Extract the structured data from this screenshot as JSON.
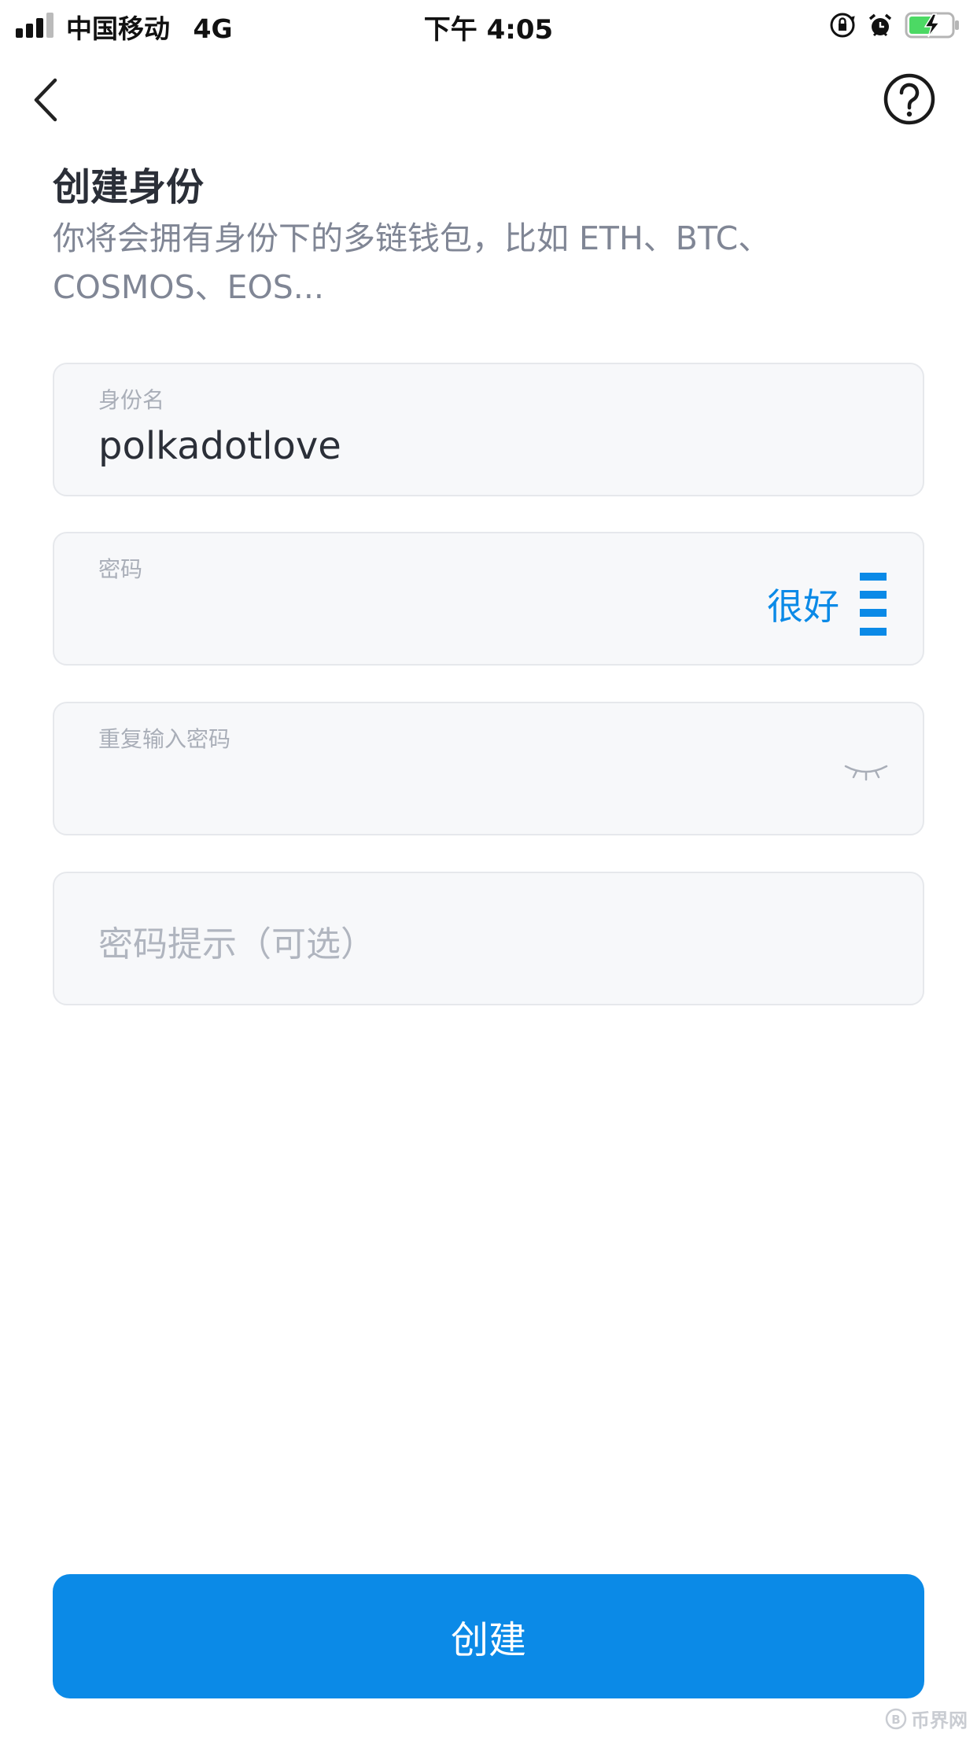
{
  "status_bar": {
    "carrier": "中国移动",
    "network": "4G",
    "time": "下午 4:05",
    "battery_color": "#4cd964"
  },
  "nav": {
    "back_icon": "chevron-left-icon",
    "help_icon": "question-circle-icon"
  },
  "header": {
    "title": "创建身份",
    "subtitle": "你将会拥有身份下的多链钱包，比如 ETH、BTC、COSMOS、EOS..."
  },
  "form": {
    "identity_name": {
      "label": "身份名",
      "value": "polkadotlove"
    },
    "password": {
      "label": "密码",
      "value": "",
      "strength_text": "很好",
      "strength_level": "4 of 4"
    },
    "repeat_password": {
      "label": "重复输入密码",
      "value": "",
      "toggle_icon": "eye-closed-icon"
    },
    "hint": {
      "placeholder": "密码提示（可选）"
    }
  },
  "actions": {
    "create_label": "创建"
  },
  "watermark": {
    "text": "币界网"
  },
  "colors": {
    "accent": "#0b8ae7",
    "field_bg": "#f7f8fa",
    "field_border": "#e6e8ec",
    "title": "#2b2f38",
    "subtitle": "#808695",
    "label": "#a9aeb8"
  }
}
